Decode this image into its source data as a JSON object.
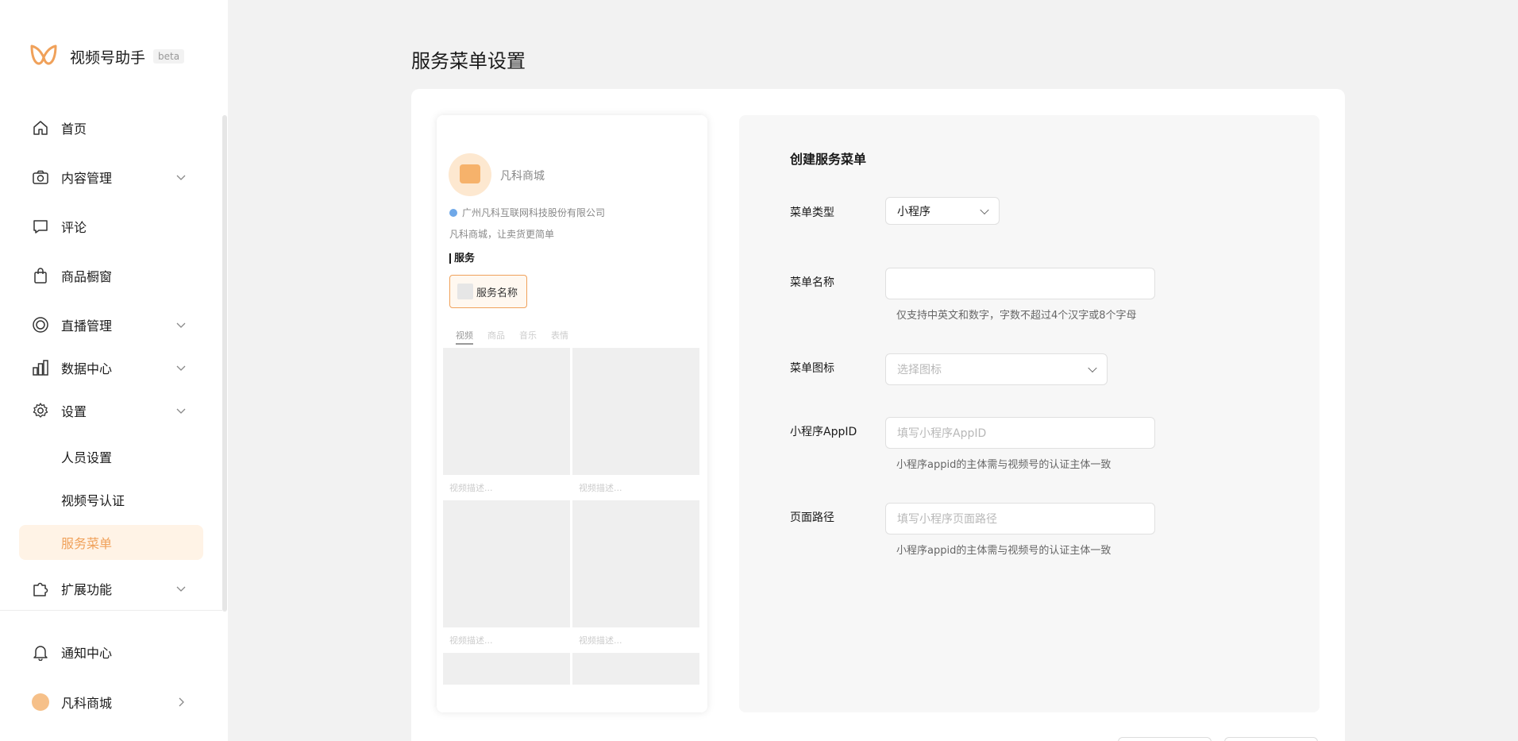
{
  "app": {
    "name": "视频号助手",
    "badge": "beta",
    "brand_color": "#f0a15a"
  },
  "nav": {
    "home": "首页",
    "content": "内容管理",
    "comments": "评论",
    "shop": "商品橱窗",
    "live": "直播管理",
    "data": "数据中心",
    "settings": "设置",
    "settings_children": [
      "人员设置",
      "视频号认证",
      "服务菜单"
    ],
    "extensions": "扩展功能",
    "notifications": "通知中心",
    "account": "凡科商城"
  },
  "page": {
    "title": "服务菜单设置"
  },
  "preview": {
    "name": "凡科商城",
    "company": "广州凡科互联网科技股份有限公司",
    "desc": "凡科商城，让卖货更简单",
    "section": "服务",
    "service_label": "服务名称",
    "tabs": [
      "视频",
      "商品",
      "音乐",
      "表情"
    ],
    "tile_caption": "视频描述..."
  },
  "form": {
    "title": "创建服务菜单",
    "type_label": "菜单类型",
    "type_value": "小程序",
    "name_label": "菜单名称",
    "name_value": "",
    "name_hint": "仅支持中英文和数字，字数不超过4个汉字或8个字母",
    "icon_label": "菜单图标",
    "icon_placeholder": "选择图标",
    "appid_label": "小程序AppID",
    "appid_placeholder": "填写小程序AppID",
    "appid_hint": "小程序appid的主体需与视频号的认证主体一致",
    "path_label": "页面路径",
    "path_placeholder": "填写小程序页面路径",
    "path_hint": "小程序appid的主体需与视频号的认证主体一致"
  }
}
